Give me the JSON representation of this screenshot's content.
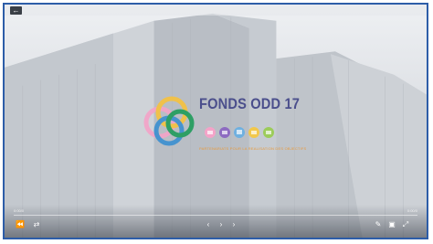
{
  "nav": {
    "back_icon": "arrow-left-icon",
    "back_glyph": "←"
  },
  "slide": {
    "title": "FONDS ODD 17",
    "subtitle": "PARTENARIATS POUR LA REALISATION DES OBJECTIFS",
    "accent_color": "#4b4f8c",
    "logo_colors": [
      "#f4a3c8",
      "#f6c23e",
      "#3a8fd1",
      "#1f9c5b",
      "#8d6bc1",
      "#6fb0e0",
      "#f2c84b",
      "#9ccc5a"
    ]
  },
  "player": {
    "time_current": "0:00/0",
    "time_total": "0:00/0",
    "progress": 0.0,
    "controls": {
      "rewind": "⏪",
      "loop": "⇄",
      "prev": "‹",
      "play_pause": "›",
      "next": "›",
      "pen": "✎",
      "caption": "▣",
      "fullscreen": "⤢"
    }
  }
}
